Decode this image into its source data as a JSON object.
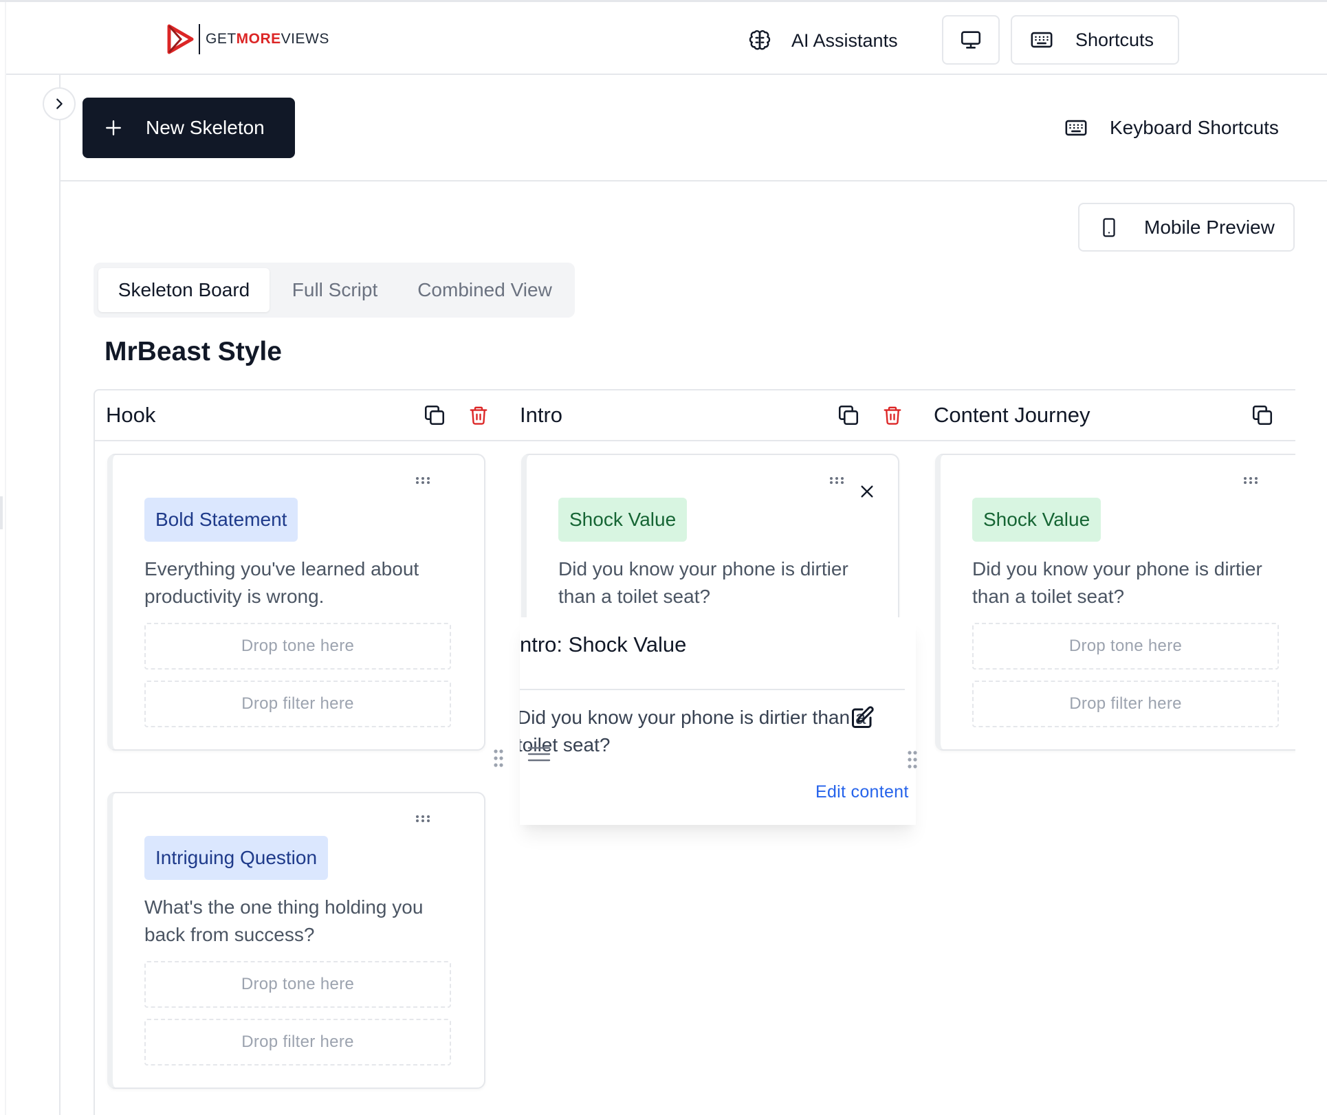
{
  "header": {
    "logo": {
      "get": "GET",
      "more": "MORE",
      "views": "VIEWS"
    },
    "ai_assistants_label": "AI Assistants",
    "shortcuts_label": "Shortcuts",
    "icons": {
      "ai": "brain-icon",
      "monitor": "monitor-icon",
      "keyboard": "keyboard-icon"
    }
  },
  "toolbar": {
    "new_skeleton_label": "New Skeleton",
    "keyboard_shortcuts_label": "Keyboard Shortcuts",
    "mobile_preview_label": "Mobile Preview"
  },
  "tabs": [
    {
      "label": "Skeleton Board",
      "active": true
    },
    {
      "label": "Full Script",
      "active": false
    },
    {
      "label": "Combined View",
      "active": false
    }
  ],
  "skeleton_title": "MrBeast Style",
  "columns": [
    {
      "title": "Hook",
      "cards": [
        {
          "badge": "Bold Statement",
          "badge_color": "#dbe7fe",
          "text": "Everything you've learned about productivity is wrong.",
          "drop_tone": "Drop tone here",
          "drop_filter": "Drop filter here"
        },
        {
          "badge": "Intriguing Question",
          "badge_color": "#dbe7fe",
          "text": "What's the one thing holding you back from success?",
          "drop_tone": "Drop tone here",
          "drop_filter": "Drop filter here"
        }
      ]
    },
    {
      "title": "Intro",
      "cards": [
        {
          "badge": "Shock Value",
          "badge_color": "#d8f5e1",
          "text": "Did you know your phone is dirtier than a toilet seat?"
        }
      ]
    },
    {
      "title": "Content Journey",
      "cards": [
        {
          "badge": "Shock Value",
          "badge_color": "#d8f5e1",
          "text": "Did you know your phone is dirtier than a toilet seat?",
          "drop_tone": "Drop tone here",
          "drop_filter": "Drop filter here"
        }
      ]
    }
  ],
  "popover": {
    "title": "ntro: Shock Value",
    "text": "Did you know your phone is dirtier than a toilet seat?",
    "edit_link": "Edit content"
  },
  "colors": {
    "primary_dark": "#111827",
    "danger": "#dc2626",
    "link": "#2563eb",
    "logo_red": "#dc2626"
  }
}
